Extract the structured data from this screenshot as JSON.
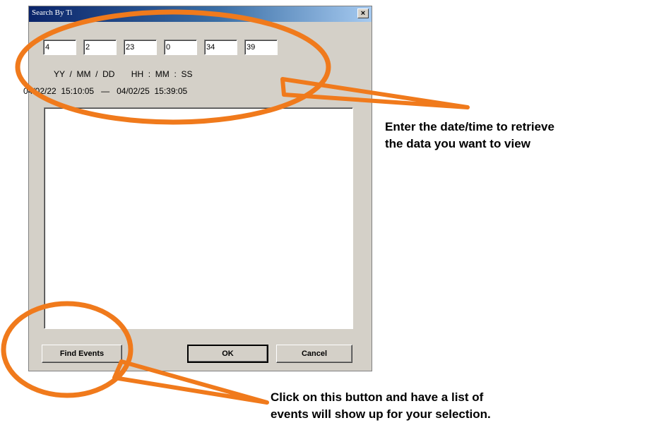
{
  "dialog": {
    "title": "Search By Ti",
    "close_glyph": "×",
    "fields": [
      "4",
      "2",
      "23",
      "0",
      "34",
      "39"
    ],
    "format_labels": "YY  /  MM  /  DD       HH  :  MM  :  SS",
    "range_text": "04/02/22  15:10:05   —   04/02/25  15:39:05",
    "find_events_label": "Find Events",
    "ok_label": "OK",
    "cancel_label": "Cancel"
  },
  "annotations": {
    "top_line1": "Enter the date/time to retrieve",
    "top_line2": "the data you want to view",
    "bottom_line1": "Click on this button and have a list of",
    "bottom_line2": "events will show up for your selection."
  },
  "colors": {
    "highlight": "#f07a1c",
    "dialog_bg": "#d4d0c8",
    "titlebar": "#0a246a"
  },
  "icons": {
    "close": "close-icon"
  }
}
